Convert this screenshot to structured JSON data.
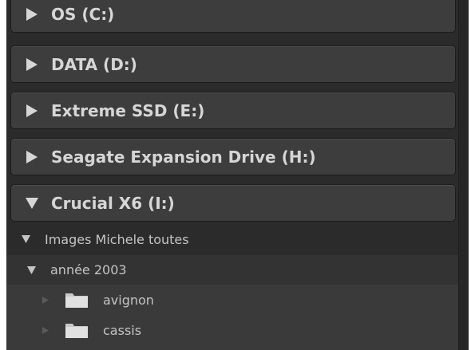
{
  "drives": [
    {
      "label": "OS (C:)",
      "state": "collapsed"
    },
    {
      "label": "DATA (D:)",
      "state": "collapsed"
    },
    {
      "label": "Extreme SSD (E:)",
      "state": "collapsed"
    },
    {
      "label": "Seagate Expansion Drive (H:)",
      "state": "collapsed"
    },
    {
      "label": "Crucial X6 (I:)",
      "state": "expanded"
    }
  ],
  "tree": {
    "root_folder": {
      "label": "Images Michele toutes",
      "state": "expanded"
    },
    "year_folder": {
      "label": "année 2003",
      "state": "expanded"
    },
    "subfolders": [
      {
        "label": "avignon",
        "icon": "folder-icon"
      },
      {
        "label": "cassis",
        "icon": "folder-icon"
      }
    ]
  },
  "colors": {
    "panel_bg": "#2b2b2b",
    "drive_header_bg": "#3d3d3d",
    "text": "#d6d6d6"
  }
}
